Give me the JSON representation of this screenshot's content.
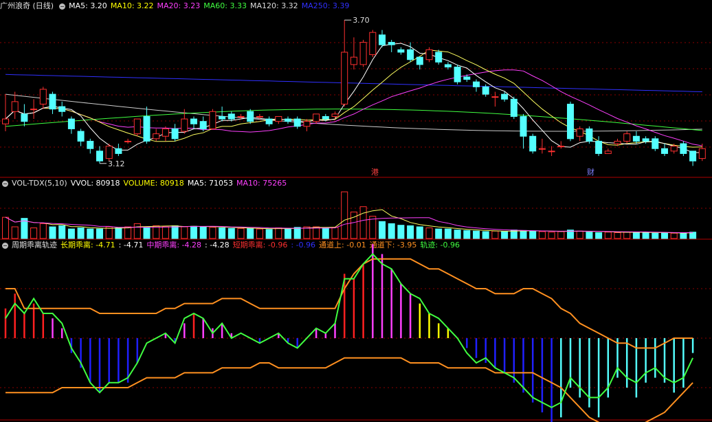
{
  "main": {
    "stock_name": "广州浪奇 (日线)",
    "ma": [
      {
        "label": "MA5: ",
        "value": "3.20",
        "color": "#ffffff"
      },
      {
        "label": "MA10: ",
        "value": "3.22",
        "color": "#ffff00"
      },
      {
        "label": "MA20: ",
        "value": "3.23",
        "color": "#ff40ff"
      },
      {
        "label": "MA60: ",
        "value": "3.33",
        "color": "#40ff40"
      },
      {
        "label": "MA120: ",
        "value": "3.32",
        "color": "#dddddd"
      },
      {
        "label": "MA250: ",
        "value": "3.39",
        "color": "#3030ff"
      }
    ],
    "high_label": "3.70",
    "low_label": "3.12",
    "marker_hk": "港",
    "marker_cai": "财"
  },
  "volume": {
    "title": "VOL-TDX(5,10)",
    "items": [
      {
        "label": "VVOL: ",
        "value": "80918",
        "color": "#ffffff"
      },
      {
        "label": "VOLUME: ",
        "value": "80918",
        "color": "#ffff00"
      },
      {
        "label": "MA5: ",
        "value": "71053",
        "color": "#ffffff"
      },
      {
        "label": "MA10: ",
        "value": "75265",
        "color": "#ff40ff"
      }
    ]
  },
  "indicator": {
    "title": "周期乖离轨迹",
    "items": [
      {
        "label": "长期乖离: ",
        "value": "-4.71",
        "color": "#ffff00"
      },
      {
        "label": ": ",
        "value": "-4.71",
        "color": "#ffffff"
      },
      {
        "label": "中期乖离: ",
        "value": "-4.28",
        "color": "#ff40ff"
      },
      {
        "label": ": ",
        "value": "-4.28",
        "color": "#ffffff"
      },
      {
        "label": "短期乖离: ",
        "value": "-0.96",
        "color": "#ff3030"
      },
      {
        "label": ": ",
        "value": "-0.96",
        "color": "#3030ff"
      },
      {
        "label": "通道上: ",
        "value": "-0.01",
        "color": "#ff9020"
      },
      {
        "label": "通道下: ",
        "value": "-3.95",
        "color": "#ff9020"
      },
      {
        "label": "轨迹: ",
        "value": "-0.96",
        "color": "#40ff40"
      }
    ]
  },
  "colors": {
    "up": "#ff3030",
    "down": "#54ffff",
    "grid": "#8b0000",
    "ma5": "#ffffff",
    "ma10": "#ffff60",
    "ma20": "#ff40ff",
    "ma60": "#40ff40",
    "ma120": "#cccccc",
    "ma250": "#3030ff",
    "channel": "#ff9020",
    "track": "#40ff40",
    "bar_pos": "#ff2020",
    "bar_neg": "#2020ff",
    "bar_mag": "#ff40ff",
    "bar_yel": "#ffff00",
    "bar_cyan": "#54ffff"
  },
  "chart_data": {
    "type": "candlestick",
    "candles": [
      {
        "o": 3.28,
        "c": 3.3,
        "h": 3.4,
        "l": 3.25
      },
      {
        "o": 3.33,
        "c": 3.37,
        "h": 3.41,
        "l": 3.3
      },
      {
        "o": 3.32,
        "c": 3.29,
        "h": 3.36,
        "l": 3.27
      },
      {
        "o": 3.34,
        "c": 3.34,
        "h": 3.38,
        "l": 3.3
      },
      {
        "o": 3.36,
        "c": 3.42,
        "h": 3.43,
        "l": 3.34
      },
      {
        "o": 3.4,
        "c": 3.34,
        "h": 3.41,
        "l": 3.32
      },
      {
        "o": 3.35,
        "c": 3.33,
        "h": 3.37,
        "l": 3.31
      },
      {
        "o": 3.3,
        "c": 3.26,
        "h": 3.31,
        "l": 3.24
      },
      {
        "o": 3.25,
        "c": 3.21,
        "h": 3.26,
        "l": 3.19
      },
      {
        "o": 3.21,
        "c": 3.18,
        "h": 3.22,
        "l": 3.16
      },
      {
        "o": 3.17,
        "c": 3.13,
        "h": 3.19,
        "l": 3.12
      },
      {
        "o": 3.14,
        "c": 3.19,
        "h": 3.2,
        "l": 3.13
      },
      {
        "o": 3.18,
        "c": 3.16,
        "h": 3.2,
        "l": 3.15
      },
      {
        "o": 3.21,
        "c": 3.21,
        "h": 3.22,
        "l": 3.2
      },
      {
        "o": 3.24,
        "c": 3.3,
        "h": 3.3,
        "l": 3.23
      },
      {
        "o": 3.31,
        "c": 3.21,
        "h": 3.35,
        "l": 3.2
      },
      {
        "o": 3.22,
        "c": 3.24,
        "h": 3.26,
        "l": 3.21
      },
      {
        "o": 3.23,
        "c": 3.26,
        "h": 3.27,
        "l": 3.21
      },
      {
        "o": 3.26,
        "c": 3.22,
        "h": 3.28,
        "l": 3.21
      },
      {
        "o": 3.25,
        "c": 3.3,
        "h": 3.34,
        "l": 3.24
      },
      {
        "o": 3.3,
        "c": 3.28,
        "h": 3.31,
        "l": 3.26
      },
      {
        "o": 3.29,
        "c": 3.26,
        "h": 3.31,
        "l": 3.25
      },
      {
        "o": 3.26,
        "c": 3.33,
        "h": 3.34,
        "l": 3.26
      },
      {
        "o": 3.31,
        "c": 3.3,
        "h": 3.35,
        "l": 3.29
      },
      {
        "o": 3.32,
        "c": 3.3,
        "h": 3.33,
        "l": 3.29
      },
      {
        "o": 3.31,
        "c": 3.31,
        "h": 3.32,
        "l": 3.3
      },
      {
        "o": 3.33,
        "c": 3.29,
        "h": 3.34,
        "l": 3.28
      },
      {
        "o": 3.31,
        "c": 3.31,
        "h": 3.32,
        "l": 3.3
      },
      {
        "o": 3.3,
        "c": 3.28,
        "h": 3.31,
        "l": 3.27
      },
      {
        "o": 3.29,
        "c": 3.31,
        "h": 3.31,
        "l": 3.28
      },
      {
        "o": 3.3,
        "c": 3.29,
        "h": 3.31,
        "l": 3.28
      },
      {
        "o": 3.3,
        "c": 3.27,
        "h": 3.31,
        "l": 3.26
      },
      {
        "o": 3.27,
        "c": 3.29,
        "h": 3.3,
        "l": 3.25
      },
      {
        "o": 3.29,
        "c": 3.32,
        "h": 3.32,
        "l": 3.28
      },
      {
        "o": 3.31,
        "c": 3.3,
        "h": 3.32,
        "l": 3.29
      },
      {
        "o": 3.31,
        "c": 3.32,
        "h": 3.33,
        "l": 3.3
      },
      {
        "o": 3.36,
        "c": 3.57,
        "h": 3.7,
        "l": 3.35
      },
      {
        "o": 3.52,
        "c": 3.55,
        "h": 3.63,
        "l": 3.5
      },
      {
        "o": 3.52,
        "c": 3.61,
        "h": 3.62,
        "l": 3.51
      },
      {
        "o": 3.56,
        "c": 3.65,
        "h": 3.66,
        "l": 3.55
      },
      {
        "o": 3.64,
        "c": 3.6,
        "h": 3.66,
        "l": 3.59
      },
      {
        "o": 3.61,
        "c": 3.6,
        "h": 3.62,
        "l": 3.57
      },
      {
        "o": 3.58,
        "c": 3.57,
        "h": 3.59,
        "l": 3.56
      },
      {
        "o": 3.58,
        "c": 3.54,
        "h": 3.61,
        "l": 3.53
      },
      {
        "o": 3.55,
        "c": 3.52,
        "h": 3.55,
        "l": 3.5
      },
      {
        "o": 3.54,
        "c": 3.58,
        "h": 3.59,
        "l": 3.53
      },
      {
        "o": 3.57,
        "c": 3.53,
        "h": 3.58,
        "l": 3.52
      },
      {
        "o": 3.52,
        "c": 3.51,
        "h": 3.53,
        "l": 3.5
      },
      {
        "o": 3.51,
        "c": 3.45,
        "h": 3.52,
        "l": 3.44
      },
      {
        "o": 3.47,
        "c": 3.46,
        "h": 3.48,
        "l": 3.45
      },
      {
        "o": 3.45,
        "c": 3.43,
        "h": 3.46,
        "l": 3.41
      },
      {
        "o": 3.43,
        "c": 3.4,
        "h": 3.44,
        "l": 3.39
      },
      {
        "o": 3.39,
        "c": 3.39,
        "h": 3.41,
        "l": 3.35
      },
      {
        "o": 3.4,
        "c": 3.38,
        "h": 3.41,
        "l": 3.37
      },
      {
        "o": 3.38,
        "c": 3.31,
        "h": 3.39,
        "l": 3.3
      },
      {
        "o": 3.31,
        "c": 3.23,
        "h": 3.32,
        "l": 3.18
      },
      {
        "o": 3.23,
        "c": 3.17,
        "h": 3.24,
        "l": 3.16
      },
      {
        "o": 3.18,
        "c": 3.18,
        "h": 3.22,
        "l": 3.16
      },
      {
        "o": 3.17,
        "c": 3.17,
        "h": 3.19,
        "l": 3.15
      },
      {
        "o": 3.19,
        "c": 3.19,
        "h": 3.21,
        "l": 3.18
      },
      {
        "o": 3.36,
        "c": 3.22,
        "h": 3.37,
        "l": 3.21
      },
      {
        "o": 3.23,
        "c": 3.26,
        "h": 3.27,
        "l": 3.21
      },
      {
        "o": 3.26,
        "c": 3.21,
        "h": 3.27,
        "l": 3.2
      },
      {
        "o": 3.21,
        "c": 3.16,
        "h": 3.23,
        "l": 3.15
      },
      {
        "o": 3.16,
        "c": 3.17,
        "h": 3.18,
        "l": 3.16
      },
      {
        "o": 3.2,
        "c": 3.21,
        "h": 3.22,
        "l": 3.19
      },
      {
        "o": 3.21,
        "c": 3.24,
        "h": 3.25,
        "l": 3.2
      },
      {
        "o": 3.23,
        "c": 3.21,
        "h": 3.25,
        "l": 3.2
      },
      {
        "o": 3.22,
        "c": 3.21,
        "h": 3.23,
        "l": 3.2
      },
      {
        "o": 3.22,
        "c": 3.18,
        "h": 3.23,
        "l": 3.17
      },
      {
        "o": 3.18,
        "c": 3.16,
        "h": 3.2,
        "l": 3.15
      },
      {
        "o": 3.17,
        "c": 3.19,
        "h": 3.2,
        "l": 3.16
      },
      {
        "o": 3.2,
        "c": 3.16,
        "h": 3.21,
        "l": 3.15
      },
      {
        "o": 3.17,
        "c": 3.13,
        "h": 3.17,
        "l": 3.11
      },
      {
        "o": 3.14,
        "c": 3.18,
        "h": 3.2,
        "l": 3.13
      }
    ],
    "volume": [
      40,
      22,
      38,
      20,
      28,
      22,
      24,
      18,
      20,
      18,
      18,
      22,
      20,
      22,
      28,
      21,
      24,
      22,
      24,
      22,
      23,
      22,
      21,
      20,
      19,
      19,
      19,
      18,
      17,
      20,
      19,
      21,
      22,
      22,
      20,
      21,
      88,
      50,
      60,
      42,
      32,
      28,
      25,
      24,
      22,
      20,
      18,
      18,
      16,
      15,
      14,
      13,
      14,
      13,
      16,
      15,
      14,
      13,
      12,
      13,
      16,
      14,
      12,
      11,
      12,
      11,
      12,
      12,
      11,
      10,
      11,
      10,
      10,
      12
    ],
    "bias": [
      6,
      9,
      5,
      7,
      5,
      4,
      2,
      -3,
      -6,
      -9,
      -11,
      -9,
      -9,
      -9,
      -5,
      0,
      0,
      1,
      -1,
      3,
      5,
      4,
      2,
      3,
      1,
      0,
      0,
      -1,
      0,
      1,
      -1,
      -2,
      0,
      2,
      1,
      3,
      13,
      12,
      15,
      19,
      17,
      14,
      11,
      9,
      7,
      5,
      3,
      2,
      0,
      -2,
      -4,
      -5,
      -6,
      -7,
      -9,
      -11,
      -13,
      -15,
      -17,
      -16,
      -10,
      -12,
      -14,
      -16,
      -12,
      -8,
      -10,
      -12,
      -9,
      -8,
      -9,
      -11,
      -10,
      -3
    ],
    "track": [
      4,
      7,
      5,
      8,
      5,
      5,
      3,
      -2,
      -5,
      -9,
      -11,
      -9,
      -9,
      -8,
      -5,
      -1,
      0,
      1,
      -1,
      4,
      5,
      4,
      1,
      3,
      0,
      1,
      0,
      -1,
      0,
      1,
      -1,
      -2,
      0,
      2,
      1,
      3,
      12,
      12,
      15,
      17,
      15,
      14,
      11,
      9,
      8,
      5,
      4,
      2,
      0,
      -3,
      -5,
      -4,
      -6,
      -7,
      -8,
      -10,
      -12,
      -13,
      -14,
      -13,
      -8,
      -10,
      -12,
      -12,
      -10,
      -6,
      -8,
      -9,
      -7,
      -6,
      -8,
      -9,
      -8,
      -4
    ],
    "chan_up": [
      10,
      10,
      6,
      6,
      6,
      6,
      6,
      6,
      6,
      6,
      5,
      5,
      5,
      5,
      5,
      5,
      5,
      6,
      6,
      7,
      7,
      7,
      7,
      8,
      8,
      8,
      7,
      6,
      6,
      6,
      6,
      6,
      6,
      6,
      6,
      6,
      10,
      13,
      15,
      16,
      16,
      16,
      16,
      16,
      15,
      14,
      14,
      13,
      12,
      11,
      10,
      10,
      9,
      9,
      9,
      10,
      10,
      9,
      8,
      6,
      5,
      3,
      2,
      1,
      0,
      -1,
      -1,
      -2,
      -2,
      -2,
      -1,
      0,
      0,
      0
    ],
    "chan_dn": [
      -11,
      -11,
      -11,
      -11,
      -11,
      -11,
      -10,
      -10,
      -10,
      -10,
      -10,
      -10,
      -10,
      -10,
      -9,
      -8,
      -8,
      -8,
      -8,
      -7,
      -7,
      -7,
      -7,
      -6,
      -6,
      -6,
      -6,
      -5,
      -5,
      -6,
      -6,
      -6,
      -6,
      -6,
      -6,
      -5,
      -4,
      -4,
      -4,
      -4,
      -4,
      -4,
      -4,
      -5,
      -5,
      -5,
      -5,
      -6,
      -6,
      -6,
      -6,
      -6,
      -7,
      -7,
      -7,
      -7,
      -7,
      -8,
      -9,
      -10,
      -12,
      -14,
      -16,
      -17,
      -18,
      -18,
      -18,
      -18,
      -17,
      -16,
      -15,
      -13,
      -11,
      -9
    ]
  }
}
